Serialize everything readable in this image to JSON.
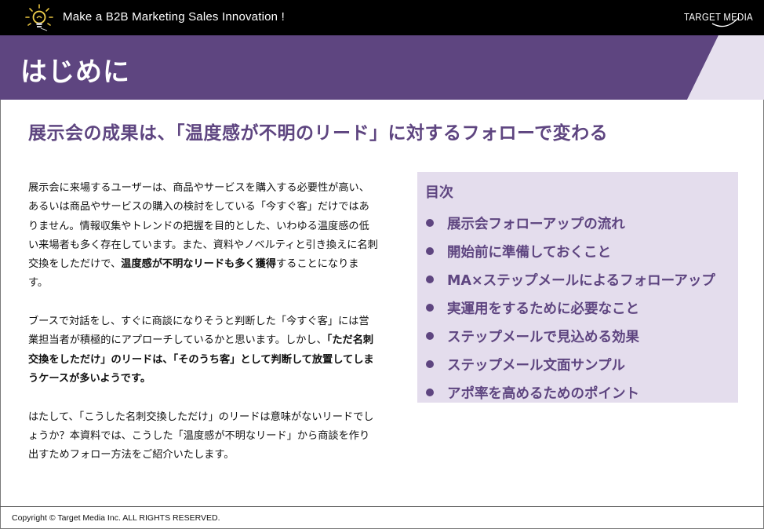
{
  "header": {
    "tagline": "Make a B2B Marketing Sales Innovation !",
    "brand": "TARGET MEDIA"
  },
  "title": "はじめに",
  "subheading": "展示会の成果は、「温度感が不明のリード」に対するフォローで変わる",
  "body": {
    "p1_a": "展示会に来場するユーザーは、商品やサービスを購入する必要性が高い、あるいは商品やサービスの購入の検討をしている「今すぐ客」だけではありません。情報収集やトレンドの把握を目的とした、いわゆる温度感の低い来場者も多く存在しています。また、資料やノベルティと引き換えに名刺交換をしただけで、",
    "p1_bold": "温度感が不明なリードも多く獲得",
    "p1_b": "することになります。",
    "p2_a": "ブースで対話をし、すぐに商談になりそうと判断した「今すぐ客」には営業担当者が積極的にアプローチしているかと思います。しかし、",
    "p2_bold": "「ただ名刺交換をしただけ」のリードは、「そのうち客」として判断して放置してしまうケースが多いようです。",
    "p3": "はたして、「こうした名刺交換しただけ」のリードは意味がないリードでしょうか？本資料では、こうした「温度感が不明なリード」から商談を作り出すためフォロー方法をご紹介いたします。"
  },
  "toc": {
    "title": "目次",
    "items": [
      "展示会フォローアップの流れ",
      "開始前に準備しておくこと",
      "MA×ステップメールによるフォローアップ",
      "実運用をするために必要なこと",
      "ステップメールで見込める効果",
      "ステップメール文面サンプル",
      "アポ率を高めるためのポイント"
    ]
  },
  "footer": {
    "copyright": "Copyright © Target Media Inc. ALL RIGHTS RESERVED."
  },
  "colors": {
    "title_band": "#5e4580",
    "title_band_edge": "#e6e0ee",
    "toc_bg": "#e4dded",
    "accent": "#5e4580"
  },
  "icons": {
    "header_logo": "lightbulb-icon",
    "toc_bullet": "bullet-dot-icon"
  }
}
